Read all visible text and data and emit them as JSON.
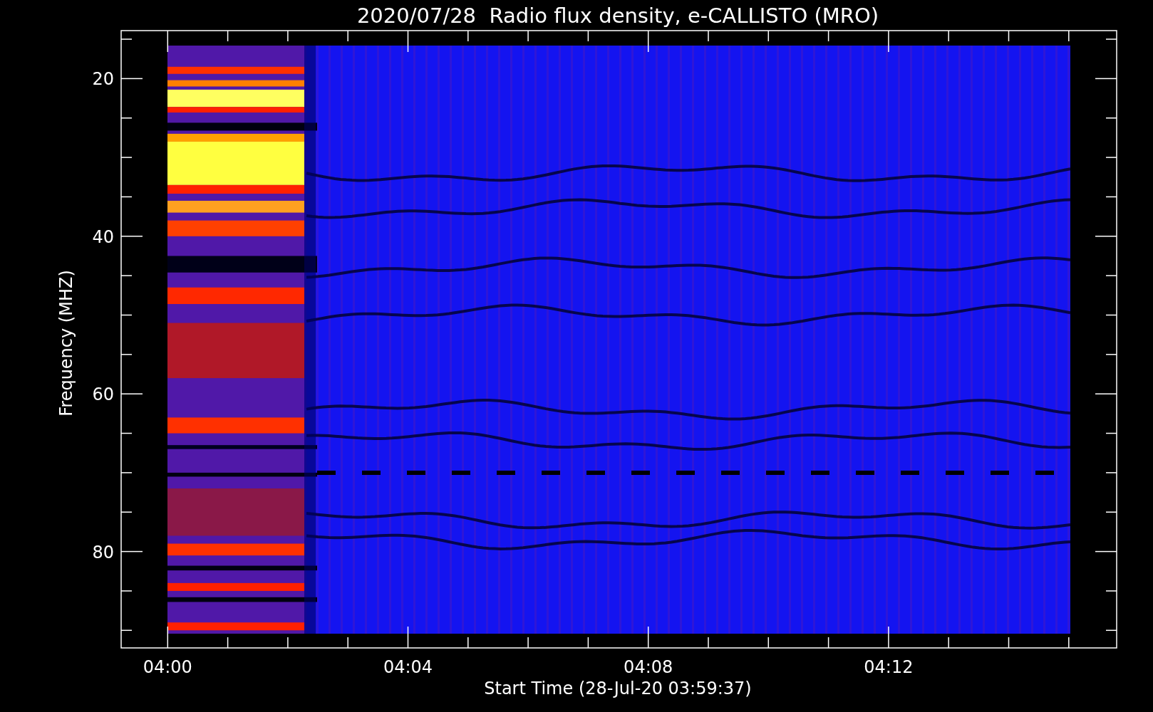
{
  "title": "2020/07/28  Radio flux density, e-CALLISTO (MRO)",
  "y_axis": {
    "label": "Frequency (MHZ)",
    "ticks": [
      "20",
      "40",
      "60",
      "80"
    ]
  },
  "x_axis": {
    "label": "Start Time (28-Jul-20 03:59:37)",
    "ticks": [
      "04:00",
      "04:04",
      "04:08",
      "04:12"
    ]
  }
}
